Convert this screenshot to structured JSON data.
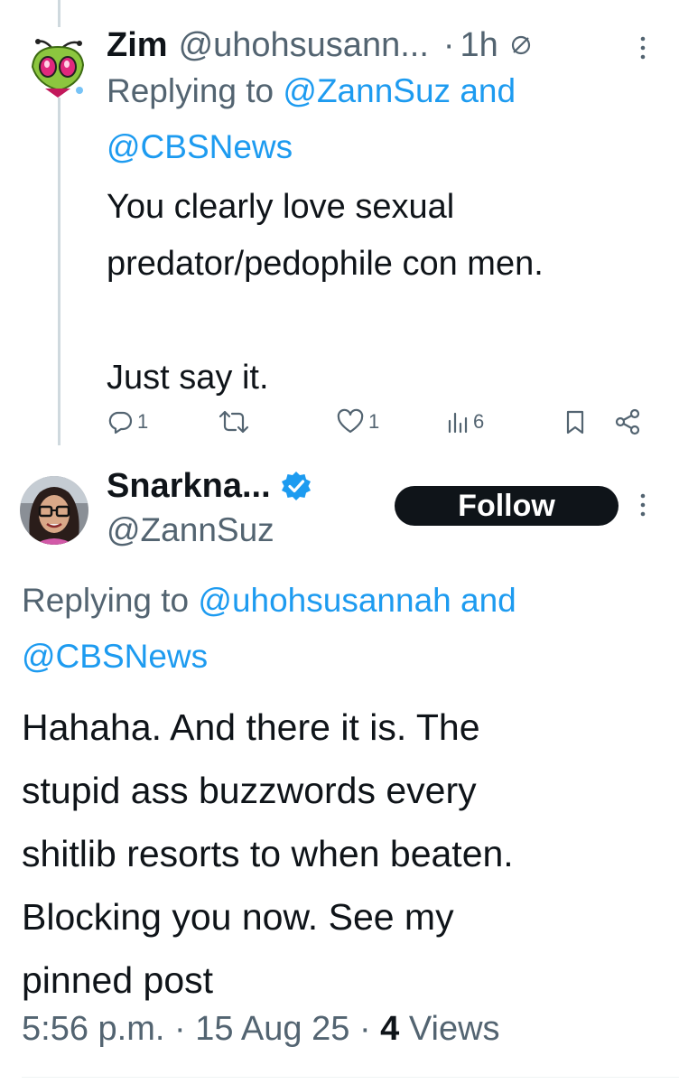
{
  "reply_tweet": {
    "display_name": "Zim",
    "handle": "@uhohsusann...",
    "separator": "·",
    "time": "1h",
    "replying_prefix": "Replying to",
    "replying_mention_1": "@ZannSuz",
    "replying_and": "and",
    "replying_mention_2": "@CBSNews",
    "text_lines": [
      "You clearly love sexual",
      "predator/pedophile con men.",
      "Just say it."
    ],
    "reply_count": "1",
    "like_count": "1",
    "view_count": "6",
    "icons": [
      "edited-icon",
      "more-icon",
      "reply-icon",
      "retweet-icon",
      "like-icon",
      "views-icon",
      "bookmark-icon",
      "share-icon"
    ]
  },
  "main_tweet": {
    "display_name": "Snarkna...",
    "handle": "@ZannSuz",
    "follow_label": "Follow",
    "replying_prefix": "Replying to",
    "replying_mention_1": "@uhohsusannah",
    "replying_and": "and",
    "replying_mention_2": "@CBSNews",
    "text_lines": [
      "Hahaha. And there it is. The",
      "stupid ass buzzwords every",
      "shitlib resorts to when beaten.",
      "Blocking you now. See my",
      "pinned post"
    ],
    "time": "5:56 p.m.",
    "date": "15 Aug 25",
    "views_count": "4",
    "views_label": "Views",
    "separator": "·",
    "icons": [
      "verified-badge-icon",
      "more-icon"
    ]
  },
  "colors": {
    "text_primary": "#0f1419",
    "text_secondary": "#536471",
    "link": "#1d9bf0",
    "verified": "#1d9bf0",
    "follow_button_bg": "#0f1419",
    "follow_button_text": "#ffffff",
    "thread_line": "#cfd9de"
  }
}
